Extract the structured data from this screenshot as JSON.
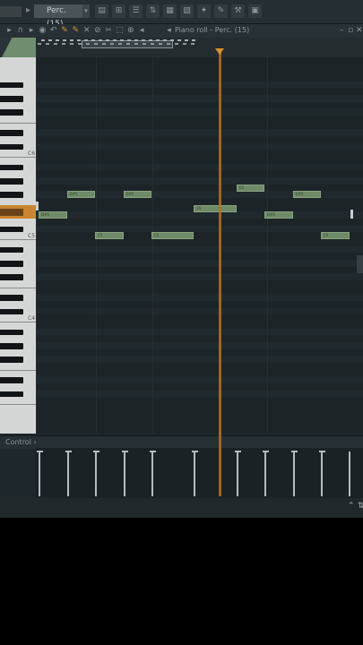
{
  "toolbar": {
    "pattern_label": "Perc. (15)",
    "pattern_caret": "▾",
    "arrow": "▸",
    "buttons": [
      {
        "name": "piano-roll-icon",
        "glyph": "▤"
      },
      {
        "name": "step-seq-icon",
        "glyph": "⊞"
      },
      {
        "name": "playlist-icon",
        "glyph": "☰"
      },
      {
        "name": "mixer-icon",
        "glyph": "⇅"
      },
      {
        "name": "channel-rack-icon",
        "glyph": "▦"
      },
      {
        "name": "browser-icon",
        "glyph": "▨"
      },
      {
        "name": "plugin-icon",
        "glyph": "✦"
      },
      {
        "name": "tempo-icon",
        "glyph": "✎"
      },
      {
        "name": "wrench-icon",
        "glyph": "⚒"
      },
      {
        "name": "cpu-icon",
        "glyph": "▣"
      }
    ]
  },
  "piano_roll": {
    "title": "Piano roll - Perc. (15)",
    "title_arrow": "›",
    "speaker_glyph": "◂",
    "tools": [
      {
        "name": "menu-arrow-icon",
        "glyph": "▸"
      },
      {
        "name": "magnet-icon",
        "glyph": "∩"
      },
      {
        "name": "play-icon",
        "glyph": "▸"
      },
      {
        "name": "record-icon",
        "glyph": "◉"
      },
      {
        "name": "undo-icon",
        "glyph": "↶"
      },
      {
        "name": "pencil-icon",
        "glyph": "✎"
      },
      {
        "name": "paint-icon",
        "glyph": "✎"
      },
      {
        "name": "delete-icon",
        "glyph": "✕"
      },
      {
        "name": "mute-icon",
        "glyph": "⊘"
      },
      {
        "name": "slice-icon",
        "glyph": "✂"
      },
      {
        "name": "select-icon",
        "glyph": "⬚"
      },
      {
        "name": "zoom-icon",
        "glyph": "⊕"
      },
      {
        "name": "playback-icon",
        "glyph": "◂"
      }
    ],
    "window_buttons": [
      "–",
      "▫",
      "✕"
    ]
  },
  "keyboard": {
    "labels": [
      {
        "text": "C6",
        "key": "c6"
      },
      {
        "text": "C5",
        "key": "c5"
      },
      {
        "text": "C4",
        "key": "c4"
      }
    ]
  },
  "notes": [
    {
      "label": "D#5",
      "start": 0.0,
      "len": 1.0,
      "pitch": "D#5"
    },
    {
      "label": "D#5",
      "start": 1.0,
      "len": 1.0,
      "pitch": "F#5"
    },
    {
      "label": "C5",
      "start": 2.0,
      "len": 1.0,
      "pitch": "C5"
    },
    {
      "label": "D#5",
      "start": 3.0,
      "len": 1.0,
      "pitch": "F#5"
    },
    {
      "label": "C5",
      "start": 4.0,
      "len": 1.5,
      "pitch": "C5"
    },
    {
      "label": "E5",
      "start": 5.5,
      "len": 1.5,
      "pitch": "E5"
    },
    {
      "label": "G5",
      "start": 7.0,
      "len": 1.0,
      "pitch": "G5"
    },
    {
      "label": "D#5",
      "start": 8.0,
      "len": 1.0,
      "pitch": "D#5"
    },
    {
      "label": "D#5",
      "start": 9.0,
      "len": 1.0,
      "pitch": "F#5"
    },
    {
      "label": "C5",
      "start": 10.0,
      "len": 1.0,
      "pitch": "C5"
    }
  ],
  "playhead_step": 6.4,
  "control": {
    "label": "Control",
    "caret": "›"
  },
  "bottom": {
    "icons": [
      "⌃",
      "⇅"
    ]
  }
}
